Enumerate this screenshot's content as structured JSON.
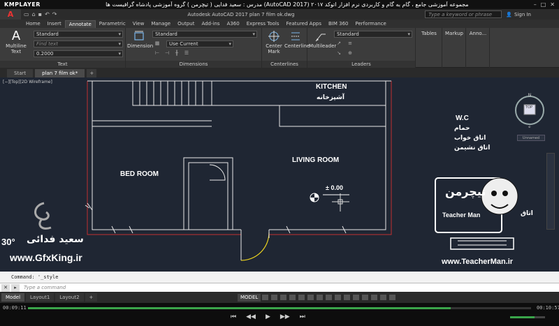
{
  "player": {
    "logo": "KMPLAYER",
    "title": "مجموعه آموزشی جامع ، گام به گام و کاربردی نرم افزار اتوکد ۲۰۱۷ (AutoCAD 2017) مدرس : سعید فدایی ( تیچرمن ) گروه آموزشی پادشاه گرافیست ها",
    "elapsed": "00:09:11",
    "total": "00:10:57",
    "progress": 0.84,
    "volume": 0.7,
    "controls": [
      "⏮",
      "◀◀",
      "▶",
      "▶▶",
      "⏭"
    ]
  },
  "acad": {
    "logo": "A",
    "doc_title": "Autodesk AutoCAD 2017    plan 7 film ok.dwg",
    "search_placeholder": "Type a keyword or phrase",
    "signin": "Sign In"
  },
  "ribbon_tabs": [
    "Home",
    "Insert",
    "Annotate",
    "Parametric",
    "View",
    "Manage",
    "Output",
    "Add-ins",
    "A360",
    "Express Tools",
    "Featured Apps",
    "BIM 360",
    "Performance"
  ],
  "active_tab": "Annotate",
  "ribbon": {
    "text_panel": {
      "label": "Text",
      "multiline_label": "Multiline Text",
      "style": "Standard",
      "find": "Find text",
      "height": "0.2000"
    },
    "dim_panel": {
      "label": "Dimensions",
      "dimension_label": "Dimension",
      "style": "Standard",
      "layer": "Use Current"
    },
    "center_panel": {
      "label": "Centerlines",
      "center_mark": "Center Mark",
      "centerline": "Centerline"
    },
    "leader_panel": {
      "label": "Leaders",
      "multileader": "Multileader",
      "style": "Standard"
    },
    "tables": "Tables",
    "markup": "Markup",
    "annotation": "Anno..."
  },
  "file_tabs": [
    "Start",
    "plan 7 film ok*"
  ],
  "viewport_label": "[−][Top][2D Wireframe]",
  "rooms": {
    "kitchen": "KITCHEN",
    "kitchen_fa": "آشپزخانه",
    "bed": "BED ROOM",
    "living": "LIVING ROOM",
    "level": "± 0.00",
    "wc": "W.C",
    "bath_fa": "حمام",
    "bedroom_fa": "اتاق خواب",
    "living_fa": "اتاق نشیمن",
    "side_fa": "اتاق",
    "unnamed": "Unnamed",
    "viewcube": "TOP"
  },
  "watermarks": {
    "gfxking": "www.GfxKing.ir",
    "teacherman": "www.TeacherMan.ir",
    "saeed_fa": "سعید فدائی",
    "deg": "30°",
    "teacher_fa": "تیچرمن",
    "teacher_en": "Teacher Man"
  },
  "command": {
    "history": "Command: '_style",
    "placeholder": "Type a command"
  },
  "status": {
    "layout_tabs": [
      "Model",
      "Layout1",
      "Layout2"
    ],
    "model_btn": "MODEL"
  }
}
